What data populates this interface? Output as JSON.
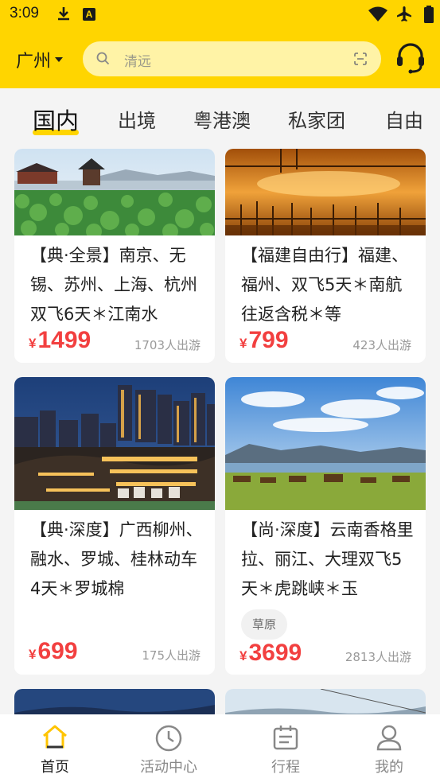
{
  "status_bar": {
    "time": "3:09"
  },
  "header": {
    "city": "广州",
    "search_placeholder": "清远"
  },
  "tabs": [
    {
      "label": "国内",
      "active": true
    },
    {
      "label": "出境"
    },
    {
      "label": "粤港澳"
    },
    {
      "label": "私家团"
    },
    {
      "label": "自由"
    }
  ],
  "products": [
    {
      "title": "【典·全景】南京、无锡、苏州、上海、杭州双飞6天＊江南水",
      "currency": "¥",
      "price": "1499",
      "count": "1703人出游"
    },
    {
      "title": "【福建自由行】福建、福州、双飞5天＊南航往返含税＊等",
      "currency": "¥",
      "price": "799",
      "count": "423人出游"
    },
    {
      "title": "【典·深度】广西柳州、融水、罗城、桂林动车4天＊罗城棉",
      "currency": "¥",
      "price": "699",
      "count": "175人出游"
    },
    {
      "title": "【尚·深度】云南香格里拉、丽江、大理双飞5天＊虎跳峡＊玉",
      "tag": "草原",
      "currency": "¥",
      "price": "3699",
      "count": "2813人出游"
    }
  ],
  "bottom_nav": [
    {
      "label": "首页",
      "icon": "home-icon",
      "active": true
    },
    {
      "label": "活动中心",
      "icon": "clock-icon"
    },
    {
      "label": "行程",
      "icon": "calendar-icon"
    },
    {
      "label": "我的",
      "icon": "user-icon"
    }
  ],
  "colors": {
    "brand": "#ffd500",
    "price": "#f24040"
  }
}
